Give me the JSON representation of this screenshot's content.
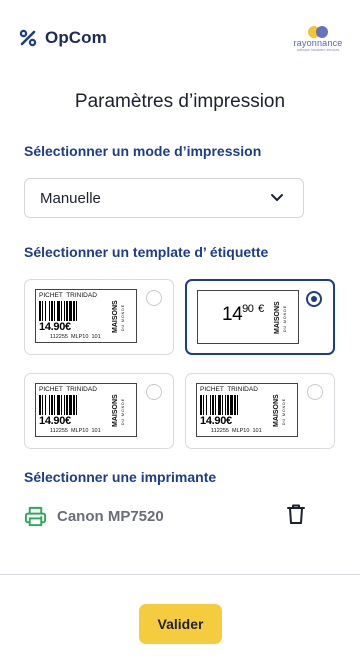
{
  "header": {
    "brand_name": "OpCom",
    "brand_icon": "percent-icon",
    "partner_logo_word": "rayonnance",
    "partner_logo_tagline": "software  hardware  services"
  },
  "page_title": "Paramètres d’impression",
  "print_mode": {
    "label": "Sélectionner un mode d’impression",
    "selected_value": "Manuelle"
  },
  "templates": {
    "label": "Sélectionner un template d’ étiquette",
    "selected_index": 1,
    "items": [
      {
        "product": "PICHET  TRINIDAD",
        "price": "14.90€",
        "codes": "112255  MLP10  101",
        "brand": "MAISONS",
        "brand_sub": "DU MONDE",
        "selected": false
      },
      {
        "price_main": "14",
        "price_cents": "90",
        "currency": "€",
        "brand": "MAISONS",
        "brand_sub": "DU MONDE",
        "selected": true
      },
      {
        "product": "PICHET  TRINIDAD",
        "price": "14.90€",
        "codes": "112255  MLP10  101",
        "brand": "MAISONS",
        "brand_sub": "DU MONDE",
        "selected": false
      },
      {
        "product": "PICHET  TRINIDAD",
        "price": "14.90€",
        "codes": "112255  MLP10  101",
        "brand": "MAISONS",
        "brand_sub": "DU MONDE",
        "selected": false
      }
    ]
  },
  "printer": {
    "label": "Sélectionner une imprimante",
    "name": "Canon MP7520",
    "icon": "printer-icon",
    "delete_icon": "trash-icon"
  },
  "footer": {
    "validate_label": "Valider"
  },
  "colors": {
    "primary": "#1c3d8a",
    "accent": "#f6cc3f",
    "printer_icon": "#2fa85a"
  }
}
